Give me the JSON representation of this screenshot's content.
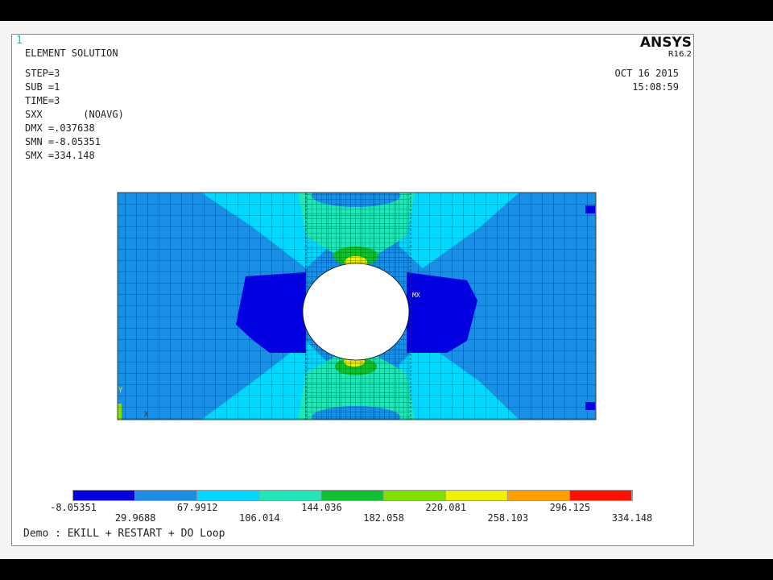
{
  "window": {
    "number": "1",
    "title": "ELEMENT SOLUTION",
    "brand": "ANSYS",
    "release": "R16.2",
    "date": "OCT 16 2015",
    "time": "15:08:59"
  },
  "info": {
    "step": "STEP=3",
    "sub": "SUB =1",
    "time": "TIME=3",
    "result": "SXX       (NOAVG)",
    "dmx": "DMX =.037638",
    "smn": "SMN =-8.05351",
    "smx": "SMX =334.148"
  },
  "markers": {
    "mx_label": "MX",
    "axis_y": "Y",
    "axis_x": "X"
  },
  "legend": {
    "colors": [
      "#0000e0",
      "#1a8fe6",
      "#00d8ff",
      "#20e6b8",
      "#10c030",
      "#80e000",
      "#f0f000",
      "#ffa000",
      "#ff1000"
    ],
    "labels_top": [
      "-8.05351",
      "67.9912",
      "144.036",
      "220.081",
      "296.125"
    ],
    "labels_bottom": [
      "29.9688",
      "106.014",
      "182.058",
      "258.103",
      "334.148"
    ]
  },
  "caption": "Demo : EKILL + RESTART + DO Loop"
}
